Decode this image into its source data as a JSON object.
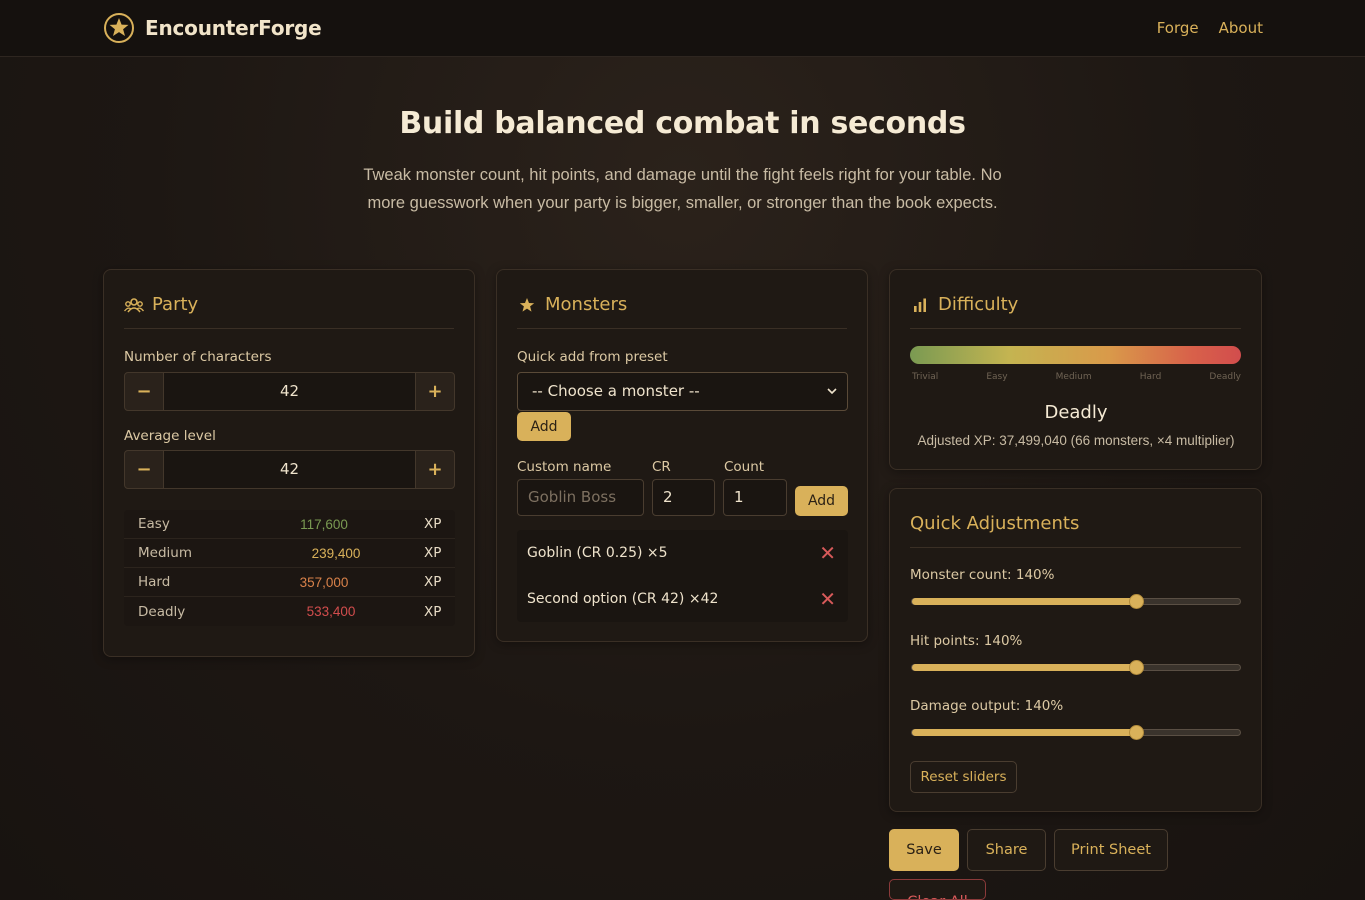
{
  "brand": {
    "name": "EncounterForge",
    "icon": "star-circle-icon"
  },
  "nav": {
    "forge": "Forge",
    "about": "About"
  },
  "hero": {
    "title": "Build balanced combat in seconds",
    "subtitle": "Tweak monster count, hit points, and damage until the fight feels right for your table. No more guesswork when your party is bigger, smaller, or stronger than the book expects."
  },
  "party": {
    "title": "Party",
    "icon": "users-icon",
    "num_chars_label": "Number of characters",
    "num_chars_value": "42",
    "avg_level_label": "Average level",
    "avg_level_value": "42",
    "minus": "−",
    "plus": "+",
    "xp_rows": [
      {
        "name": "Easy",
        "value": "117,600",
        "unit": "XP",
        "color": "#7a9a52"
      },
      {
        "name": "Medium",
        "value": "239,400",
        "unit": "XP",
        "color": "#d9b15a"
      },
      {
        "name": "Hard",
        "value": "357,000",
        "unit": "XP",
        "color": "#d9824a"
      },
      {
        "name": "Deadly",
        "value": "533,400",
        "unit": "XP",
        "color": "#d24d4d"
      }
    ]
  },
  "monsters": {
    "title": "Monsters",
    "icon": "star-icon",
    "preset_label": "Quick add from preset",
    "preset_value": "-- Choose a monster --",
    "add_label": "Add",
    "custom_name_label": "Custom name",
    "custom_name_placeholder": "Goblin Boss",
    "cr_label": "CR",
    "cr_value": "2",
    "count_label": "Count",
    "count_value": "1",
    "custom_add_label": "Add",
    "list": [
      {
        "text": "Goblin (CR 0.25) ×5",
        "remove": "✕"
      },
      {
        "text": "Second option (CR 42) ×42",
        "remove": "✕"
      }
    ]
  },
  "difficulty": {
    "title": "Difficulty",
    "icon": "bar-chart-icon",
    "ticks": [
      "Trivial",
      "Easy",
      "Medium",
      "Hard",
      "Deadly"
    ],
    "level": "Deadly",
    "adjusted": "Adjusted XP: 37,499,040 (66 monsters, ×4 multiplier)"
  },
  "adjustments": {
    "title": "Quick Adjustments",
    "sliders": [
      {
        "label": "Monster count: 140%",
        "value_pct": 140,
        "min_pct": 10,
        "max_pct": 200
      },
      {
        "label": "Hit points: 140%",
        "value_pct": 140,
        "min_pct": 10,
        "max_pct": 200
      },
      {
        "label": "Damage output: 140%",
        "value_pct": 140,
        "min_pct": 10,
        "max_pct": 200
      }
    ],
    "reset_label": "Reset sliders"
  },
  "actions": {
    "save": "Save",
    "share": "Share",
    "print": "Print Sheet",
    "clear": "Clear All"
  },
  "colors": {
    "accent": "#d9b15a",
    "danger": "#d24d4d",
    "background": "#1d1713"
  }
}
